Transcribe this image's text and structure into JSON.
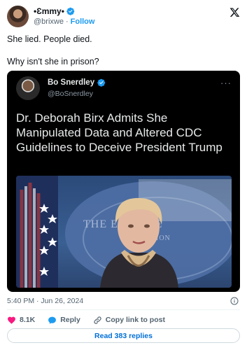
{
  "author": {
    "display_name": "•Ɛmmy•",
    "handle": "@brixwe",
    "separator": "·",
    "follow_label": "Follow"
  },
  "tweet": {
    "line1": "She lied. People died.",
    "line2": "Why isn't she in prison?"
  },
  "quoted": {
    "display_name": "Bo Snerdley",
    "handle": "@BoSnerdley",
    "more": "···",
    "headline": "Dr. Deborah Birx Admits She Manipulated Data and Altered CDC Guidelines to Deceive President Trump",
    "photo_text_main": "THE       E HOUSE",
    "photo_text_sub": "ION"
  },
  "meta": {
    "timestamp": "5:40 PM · Jun 26, 2024"
  },
  "actions": {
    "like_count": "8.1K",
    "reply_label": "Reply",
    "copy_label": "Copy link to post"
  },
  "footer": {
    "read_replies_label": "Read 383 replies"
  },
  "colors": {
    "accent": "#1d9bf0",
    "like": "#f91880",
    "text_secondary": "#536471"
  }
}
